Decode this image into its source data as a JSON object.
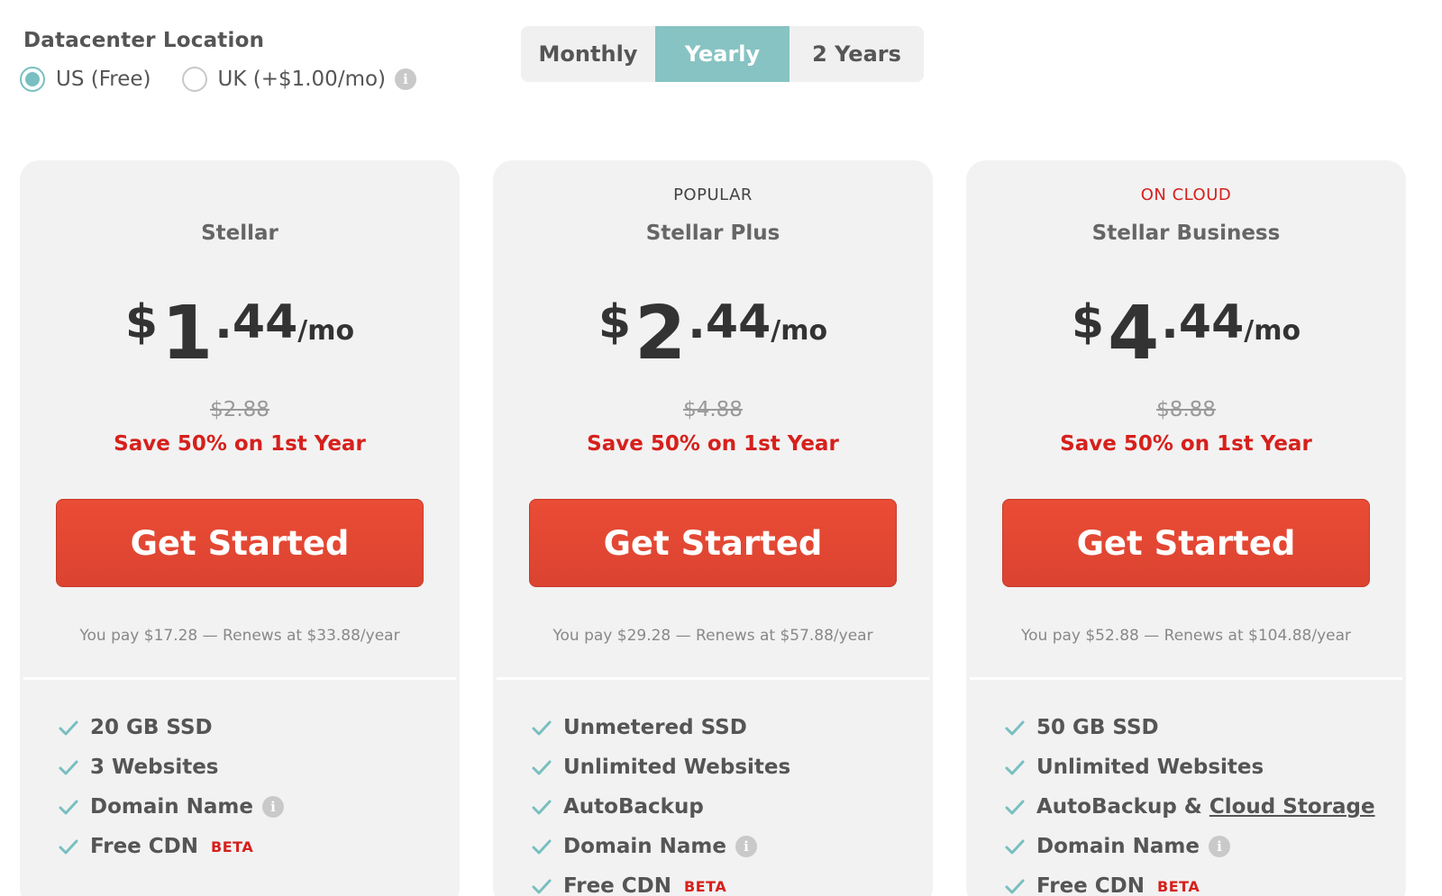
{
  "datacenter": {
    "title": "Datacenter Location",
    "options": [
      {
        "label": "US (Free)",
        "selected": true
      },
      {
        "label": "UK (+$1.00/mo)",
        "selected": false
      }
    ],
    "info_icon": "info-icon"
  },
  "billing": {
    "tabs": [
      "Monthly",
      "Yearly",
      "2 Years"
    ],
    "active": "Yearly"
  },
  "colors": {
    "accent_teal": "#87c3c3",
    "cta_red": "#e34a34",
    "save_red": "#d6201c"
  },
  "plans": [
    {
      "badge": "",
      "name": "Stellar",
      "currency": "$",
      "price_int": "1",
      "price_dec": ".44",
      "per": "/mo",
      "old_price": "$2.88",
      "save": "Save 50% on 1st Year",
      "cta": "Get Started",
      "pay_note": "You pay $17.28 — Renews at $33.88/year",
      "features": [
        {
          "text": "20 GB SSD"
        },
        {
          "text": "3 Websites"
        },
        {
          "text": "Domain Name"
        },
        {
          "text": "Free CDN",
          "tag": "BETA"
        }
      ]
    },
    {
      "badge": "POPULAR",
      "name": "Stellar Plus",
      "currency": "$",
      "price_int": "2",
      "price_dec": ".44",
      "per": "/mo",
      "old_price": "$4.88",
      "save": "Save 50% on 1st Year",
      "cta": "Get Started",
      "pay_note": "You pay $29.28 — Renews at $57.88/year",
      "features": [
        {
          "text": "Unmetered SSD"
        },
        {
          "text": "Unlimited Websites"
        },
        {
          "text": "AutoBackup"
        },
        {
          "text": "Domain Name"
        },
        {
          "text": "Free CDN",
          "tag": "BETA"
        }
      ]
    },
    {
      "badge": "ON CLOUD",
      "name": "Stellar Business",
      "currency": "$",
      "price_int": "4",
      "price_dec": ".44",
      "per": "/mo",
      "old_price": "$8.88",
      "save": "Save 50% on 1st Year",
      "cta": "Get Started",
      "pay_note": "You pay $52.88 — Renews at $104.88/year",
      "features": [
        {
          "text": "50 GB SSD"
        },
        {
          "text": "Unlimited Websites"
        },
        {
          "text": "AutoBackup &",
          "link": "Cloud Storage"
        },
        {
          "text": "Domain Name"
        },
        {
          "text": "Free CDN",
          "tag": "BETA"
        }
      ]
    }
  ]
}
